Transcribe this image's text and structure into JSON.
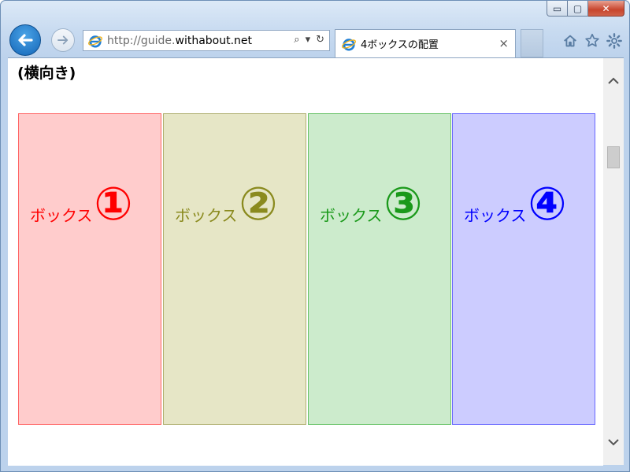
{
  "window": {
    "minimize": "▭",
    "maximize": "▢",
    "close": "✕"
  },
  "address_bar": {
    "url_prefix": "http://guide.",
    "url_domain": "withabout.net",
    "search_icon": "⌕",
    "dropdown_icon": "▾",
    "refresh_icon": "↻"
  },
  "tab": {
    "title": "4ボックスの配置",
    "close": "×"
  },
  "page": {
    "heading": "(横向き)",
    "boxes": [
      {
        "label": "ボックス",
        "number": "①",
        "fill": "#ffcccc",
        "border": "#ff6666",
        "text": "#ff0000"
      },
      {
        "label": "ボックス",
        "number": "②",
        "fill": "#e6e6c6",
        "border": "#b0b070",
        "text": "#8a8a1e"
      },
      {
        "label": "ボックス",
        "number": "③",
        "fill": "#ccebcc",
        "border": "#66c266",
        "text": "#1a991a"
      },
      {
        "label": "ボックス",
        "number": "④",
        "fill": "#ccccff",
        "border": "#6666ff",
        "text": "#0000ff"
      }
    ]
  },
  "icons": {
    "back": "arrow-left-icon",
    "forward": "arrow-right-icon",
    "home": "home-icon",
    "favorites": "star-icon",
    "tools": "gear-icon",
    "ie": "ie-logo-icon"
  }
}
